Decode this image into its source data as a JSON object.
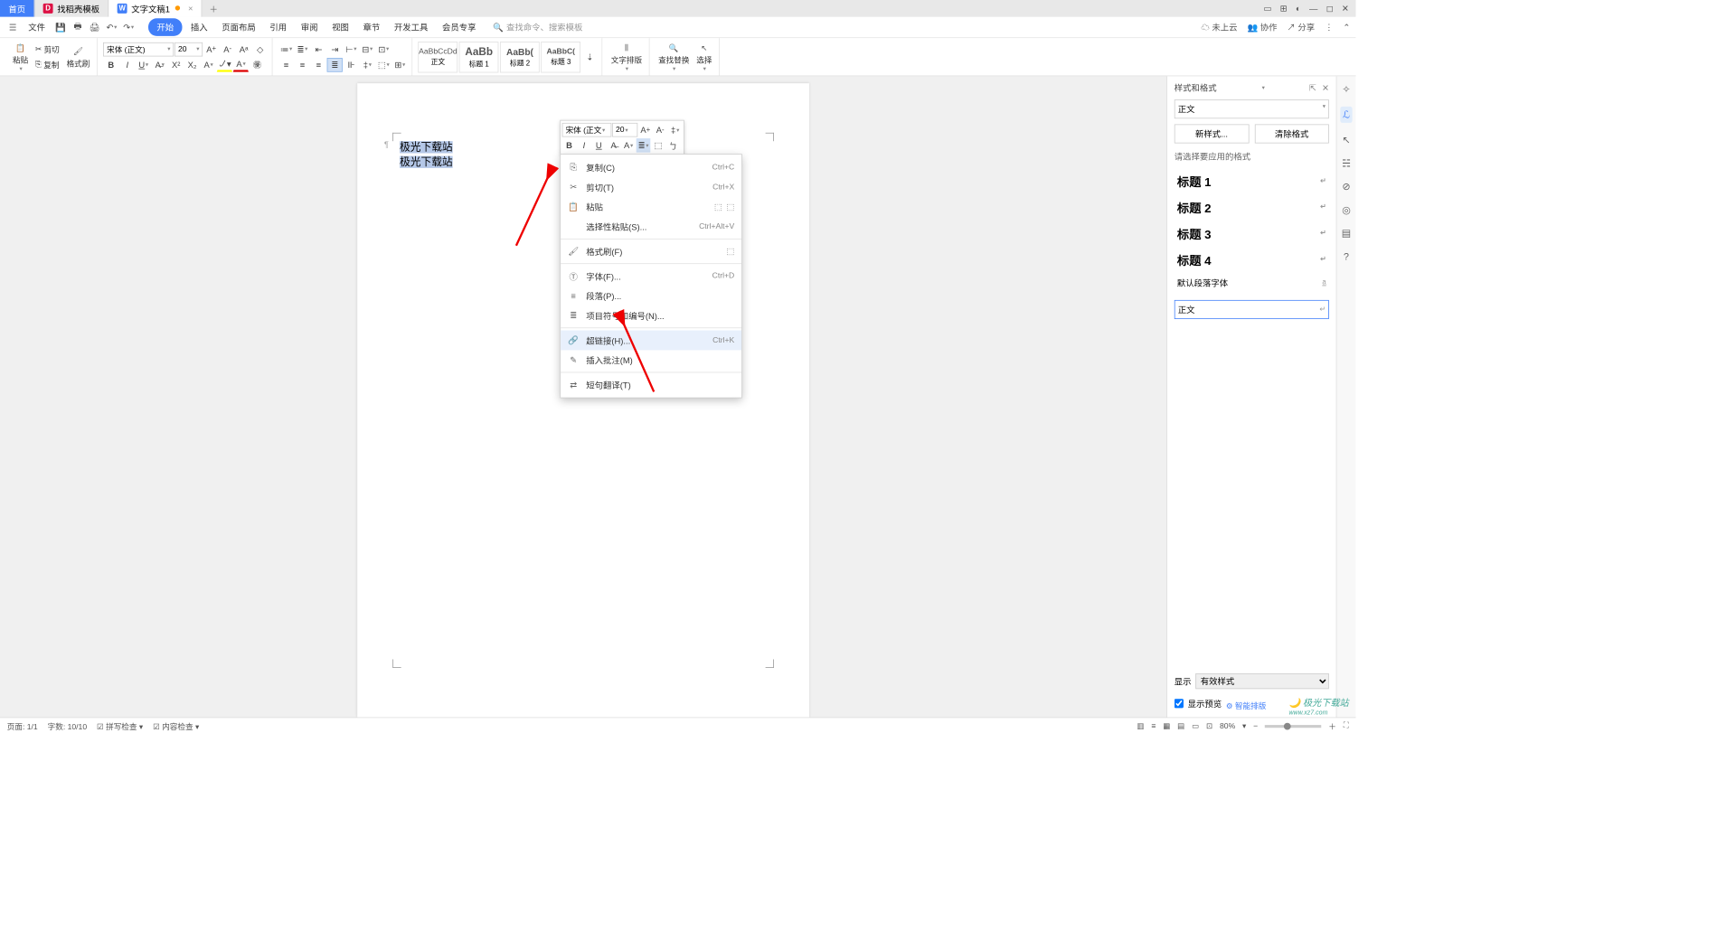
{
  "titlebar": {
    "tabs": [
      {
        "label": "首页",
        "type": "home"
      },
      {
        "label": "找稻壳模板",
        "icon": "D",
        "icon_color": "#d14"
      },
      {
        "label": "文字文稿1",
        "icon": "W",
        "icon_color": "#417ff9",
        "active": true,
        "dirty": true
      }
    ]
  },
  "menubar": {
    "file": "文件",
    "items": [
      "开始",
      "插入",
      "页面布局",
      "引用",
      "审阅",
      "视图",
      "章节",
      "开发工具",
      "会员专享"
    ],
    "active_index": 0,
    "search_placeholder": "查找命令、搜索模板",
    "right": {
      "cloud": "未上云",
      "collab": "协作",
      "share": "分享"
    }
  },
  "ribbon": {
    "paste": "粘贴",
    "cut": "剪切",
    "copy": "复制",
    "format_painter": "格式刷",
    "font_name": "宋体 (正文)",
    "font_size": "20",
    "styles": [
      {
        "preview": "AaBbCcDd",
        "name": "正文"
      },
      {
        "preview": "AaBb",
        "name": "标题 1"
      },
      {
        "preview": "AaBb(",
        "name": "标题 2"
      },
      {
        "preview": "AaBbC(",
        "name": "标题 3"
      }
    ],
    "text_layout": "文字排版",
    "find_replace": "查找替换",
    "select": "选择"
  },
  "document": {
    "line1": "极光下载站",
    "line2": "极光下载站"
  },
  "mini_toolbar": {
    "font_name": "宋体 (正文",
    "font_size": "20"
  },
  "context_menu": {
    "items": [
      {
        "icon": "⎘",
        "label": "复制(C)",
        "shortcut": "Ctrl+C"
      },
      {
        "icon": "✂",
        "label": "剪切(T)",
        "shortcut": "Ctrl+X"
      },
      {
        "icon": "📋",
        "label": "粘贴",
        "extra": true
      },
      {
        "label": "选择性粘贴(S)...",
        "shortcut": "Ctrl+Alt+V"
      },
      {
        "sep": true
      },
      {
        "icon": "🖌",
        "label": "格式刷(F)",
        "extra_single": true
      },
      {
        "sep": true
      },
      {
        "icon": "Ⓣ",
        "label": "字体(F)...",
        "shortcut": "Ctrl+D"
      },
      {
        "icon": "≡",
        "label": "段落(P)..."
      },
      {
        "icon": "≣",
        "label": "项目符号和编号(N)..."
      },
      {
        "sep": true
      },
      {
        "icon": "🔗",
        "label": "超链接(H)...",
        "shortcut": "Ctrl+K",
        "hover": true
      },
      {
        "icon": "✎",
        "label": "插入批注(M)"
      },
      {
        "sep": true
      },
      {
        "icon": "⇄",
        "label": "短句翻译(T)"
      }
    ]
  },
  "styles_panel": {
    "title": "样式和格式",
    "current": "正文",
    "new_style": "新样式...",
    "clear_format": "清除格式",
    "hint": "请选择要应用的格式",
    "styles": [
      "标题 1",
      "标题 2",
      "标题 3",
      "标题 4"
    ],
    "default_para_font": "默认段落字体",
    "normal": "正文",
    "display_label": "显示",
    "display_value": "有效样式",
    "preview_label": "显示预览",
    "smart_layout": "智能排版"
  },
  "statusbar": {
    "page": "页面: 1/1",
    "words": "字数: 10/10",
    "spell": "拼写检查",
    "content": "内容检查",
    "zoom": "80%"
  },
  "watermark": {
    "brand": "极光下载站",
    "url": "www.xz7.com"
  }
}
